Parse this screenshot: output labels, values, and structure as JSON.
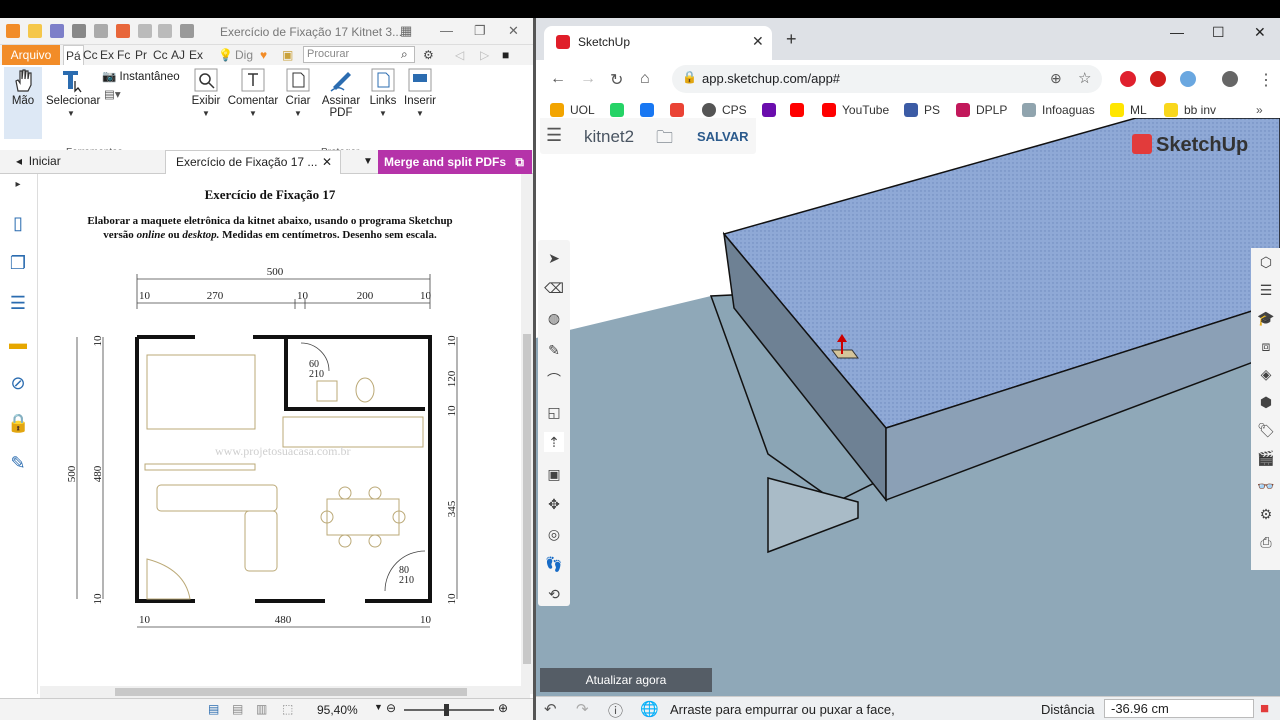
{
  "pdf": {
    "title": "Exercício de Fixação 17 Kitnet 3...",
    "ribbon_tabs": [
      "Arquivo",
      "Pá",
      "Cc",
      "Ex",
      "Fc",
      "Pr",
      "Cc",
      "AJ",
      "Ex",
      "Dig"
    ],
    "search_placeholder": "Procurar",
    "buttons": {
      "mao": "Mão",
      "selecionar": "Selecionar",
      "instantaneo": "Instantâneo",
      "exibir": "Exibir",
      "comentar": "Comentar",
      "criar": "Criar",
      "assinar": "Assinar",
      "pdf": "PDF",
      "links": "Links",
      "inserir": "Inserir"
    },
    "groups": {
      "ferramentas": "Ferramentas",
      "proteger": "Proteger"
    },
    "nav": {
      "home": "Iniciar",
      "doc_tab": "Exercício de Fixação 17 ...",
      "merge": "Merge and split PDFs"
    },
    "doc": {
      "heading": "Exercício de Fixação 17",
      "line1": "Elaborar a maquete eletrônica da kitnet abaixo, usando o programa Sketchup",
      "line2a": "versão ",
      "line2b": "online",
      "line2c": " ou ",
      "line2d": "desktop.",
      "line2e": " Medidas em centímetros. Desenho sem escala."
    },
    "plan": {
      "top_total": "500",
      "top_dims": [
        "10",
        "270",
        "10",
        "200",
        "10"
      ],
      "bottom_dims": [
        "10",
        "480",
        "10"
      ],
      "left_total": "500",
      "left_inner": "480",
      "right_dims": [
        "10",
        "120",
        "10",
        "345",
        "10"
      ],
      "left_small": [
        "10",
        "10"
      ],
      "door1": [
        "60",
        "210"
      ],
      "door2": [
        "80",
        "210"
      ],
      "watermark": "www.projetosuacasa.com.br"
    },
    "zoom": "95,40%"
  },
  "chrome": {
    "tab_title": "SketchUp",
    "url": "app.sketchup.com/app#",
    "bookmarks": [
      {
        "label": "UOL",
        "color": "#f2a400"
      },
      {
        "label": "",
        "color": "#25d366"
      },
      {
        "label": "",
        "color": "#1877f2"
      },
      {
        "label": "",
        "color": "#ea4335"
      },
      {
        "label": "CPS",
        "color": "#555"
      },
      {
        "label": "",
        "color": "#6a0dad"
      },
      {
        "label": "",
        "color": "#ff0000"
      },
      {
        "label": "YouTube",
        "color": "#ff0000"
      },
      {
        "label": "PS",
        "color": "#3b5ba5"
      },
      {
        "label": "DPLP",
        "color": "#c2185b"
      },
      {
        "label": "Infoaguas",
        "color": "#90a4ae"
      },
      {
        "label": "ML",
        "color": "#ffe600"
      },
      {
        "label": "bb inv",
        "color": "#f9d71c"
      }
    ]
  },
  "sketchup": {
    "file_name": "kitnet2",
    "save": "SALVAR",
    "logo": "SketchUp",
    "update": "Atualizar agora",
    "status_msg": "Arraste para empurrar ou puxar a face,",
    "distance_label": "Distância",
    "distance_value": "-36.96 cm"
  }
}
